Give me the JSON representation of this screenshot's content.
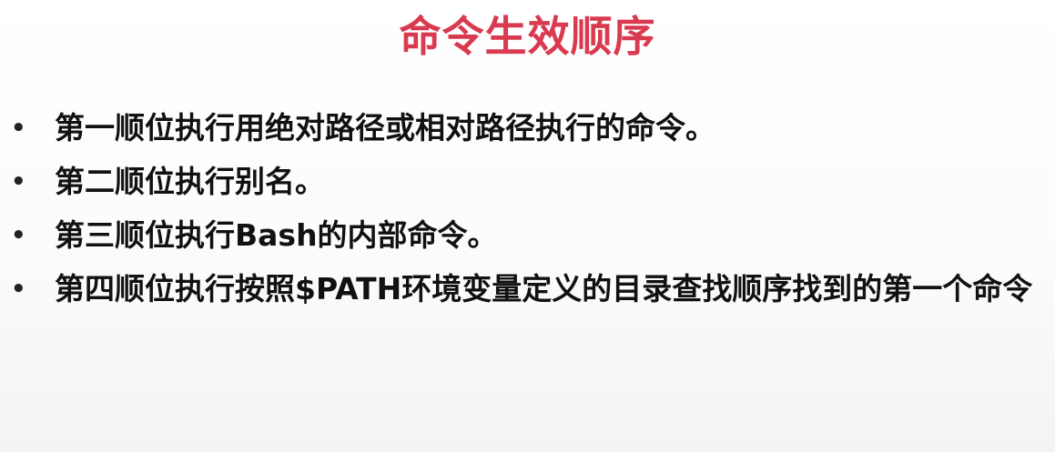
{
  "slide": {
    "title": "命令生效顺序",
    "bullets": [
      {
        "marker": "•",
        "text": "第一顺位执行用绝对路径或相对路径执行的命令。"
      },
      {
        "marker": "•",
        "text": "第二顺位执行别名。"
      },
      {
        "marker": "•",
        "text": "第三顺位执行Bash的内部命令。"
      },
      {
        "marker": "•",
        "text": "第四顺位执行按照$PATH环境变量定义的目录查找顺序找到的第一个命令"
      }
    ]
  },
  "colors": {
    "title": "#d93a4f",
    "text": "#111111",
    "background": "#ffffff"
  }
}
